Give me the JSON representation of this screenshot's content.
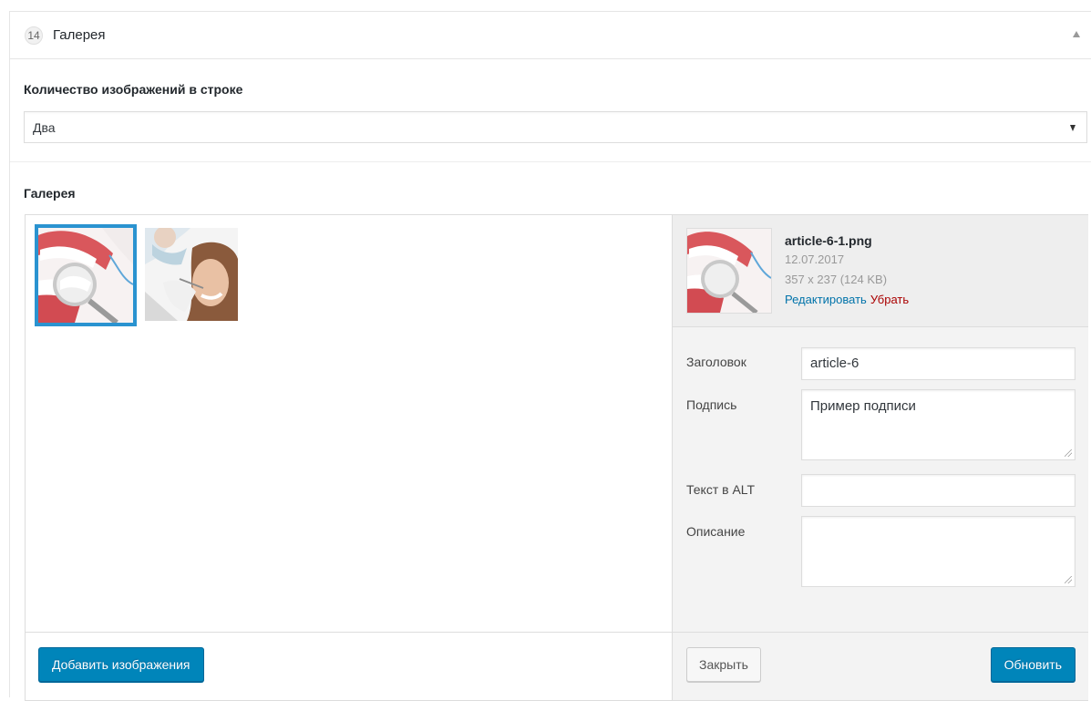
{
  "panel": {
    "order": "14",
    "title": "Галерея",
    "collapse_icon": "triangle-up-icon"
  },
  "columns_field": {
    "label": "Количество изображений в строке",
    "value": "Два"
  },
  "gallery_field": {
    "label": "Галерея"
  },
  "attachment": {
    "filename": "article-6-1.png",
    "date": "12.07.2017",
    "size": "357 x 237 (124 KB)",
    "edit_link": "Редактировать",
    "remove_link": "Убрать",
    "fields": {
      "title_label": "Заголовок",
      "title_value": "article-6",
      "caption_label": "Подпись",
      "caption_value": "Пример подписи",
      "alt_label": "Текст в ALT",
      "alt_value": "",
      "description_label": "Описание",
      "description_value": ""
    }
  },
  "buttons": {
    "add": "Добавить изображения",
    "close": "Закрыть",
    "update": "Обновить"
  },
  "colors": {
    "primary": "#0085ba",
    "selection": "#2a93d0",
    "link": "#0073aa",
    "remove": "#aa0000"
  }
}
